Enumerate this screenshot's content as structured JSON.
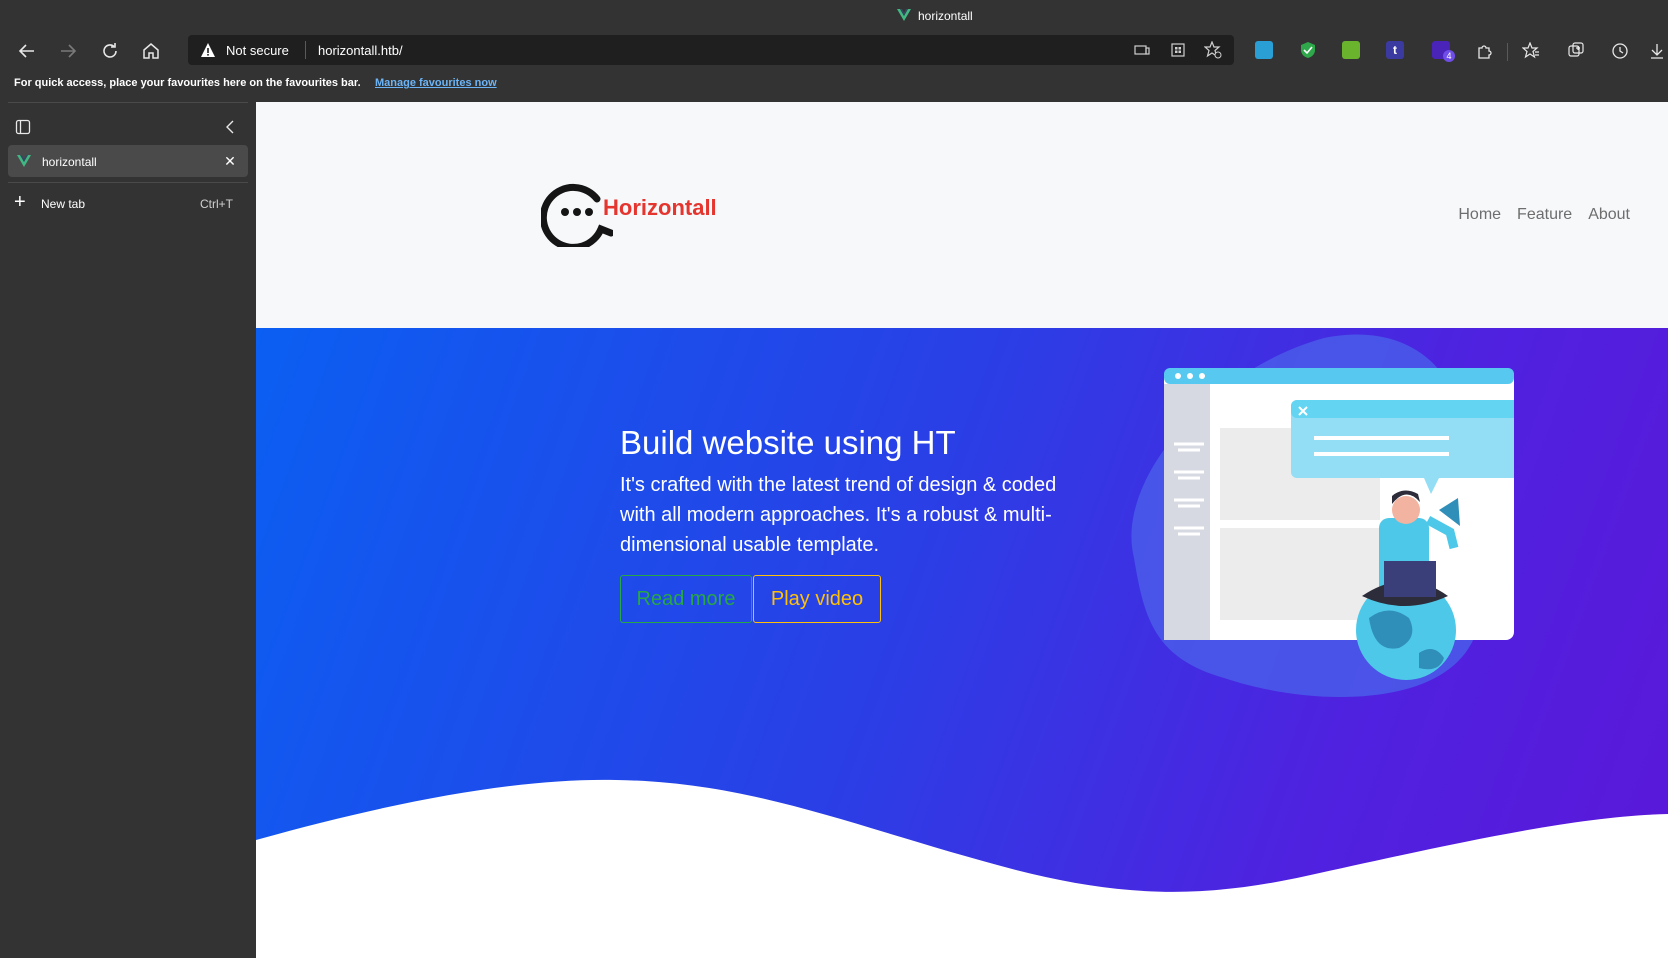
{
  "window": {
    "title": "horizontall"
  },
  "toolbar": {
    "security_label": "Not secure",
    "url": "horizontall.htb/"
  },
  "favourites_bar": {
    "message": "For quick access, place your favourites here on the favourites bar.",
    "link": "Manage favourites now"
  },
  "sidebar": {
    "tabs": [
      {
        "label": "horizontall"
      }
    ],
    "new_tab": {
      "label": "New tab",
      "shortcut": "Ctrl+T"
    }
  },
  "extensions": {
    "badge_count": "4"
  },
  "site": {
    "brand": "Horizontall",
    "nav": [
      {
        "label": "Home"
      },
      {
        "label": "Feature"
      },
      {
        "label": "About"
      }
    ],
    "hero": {
      "title": "Build website using HT",
      "text": "It's crafted with the latest trend of design & coded with all modern approaches. It's a robust & multi-dimensional usable template.",
      "read_more": "Read more",
      "play_video": "Play video"
    }
  },
  "colors": {
    "brand_red": "#e5352f",
    "read_more_green": "#28a745",
    "play_video_yellow": "#ffc107",
    "vue_green": "#41b883"
  }
}
